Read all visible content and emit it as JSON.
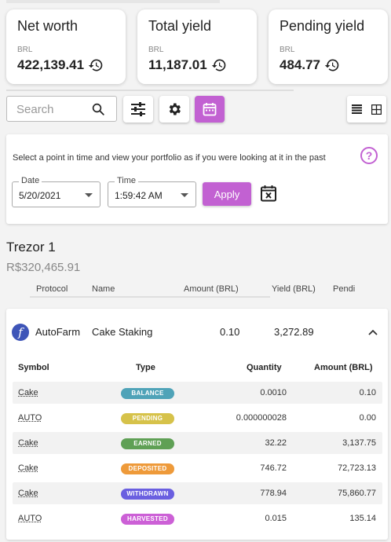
{
  "summary": [
    {
      "title": "Net worth",
      "currency": "BRL",
      "value": "422,139.41"
    },
    {
      "title": "Total yield",
      "currency": "BRL",
      "value": "11,187.01"
    },
    {
      "title": "Pending yield",
      "currency": "BRL",
      "value": "484.77"
    }
  ],
  "toolbar": {
    "search_placeholder": "Search"
  },
  "history": {
    "description": "Select a point in time and view your portfolio as if you were looking at it in the past",
    "help": "?",
    "date_label": "Date",
    "date_value": "5/20/2021",
    "time_label": "Time",
    "time_value": "1:59:42 AM",
    "apply_label": "Apply"
  },
  "wallet": {
    "name": "Trezor 1",
    "value": "R$320,465.91"
  },
  "columns": [
    "Protocol",
    "Name",
    "Amount (BRL)",
    "Yield (BRL)",
    "Pendi"
  ],
  "position": {
    "protocol": "AutoFarm",
    "name": "Cake Staking",
    "amount": "0.10",
    "yield": "3,272.89"
  },
  "table": {
    "headers": [
      "Symbol",
      "Type",
      "Quantity",
      "Amount (BRL)"
    ],
    "rows": [
      {
        "symbol": "Cake",
        "type": "BALANCE",
        "quantity": "0.0010",
        "amount": "0.10"
      },
      {
        "symbol": "AUTO",
        "type": "PENDING",
        "quantity": "0.000000028",
        "amount": "0.00"
      },
      {
        "symbol": "Cake",
        "type": "EARNED",
        "quantity": "32.22",
        "amount": "3,137.75"
      },
      {
        "symbol": "Cake",
        "type": "DEPOSITED",
        "quantity": "746.72",
        "amount": "72,723.13"
      },
      {
        "symbol": "Cake",
        "type": "WITHDRAWN",
        "quantity": "778.94",
        "amount": "75,860.77"
      },
      {
        "symbol": "AUTO",
        "type": "HARVESTED",
        "quantity": "0.015",
        "amount": "135.14"
      }
    ]
  },
  "colors": {
    "accent": "#c261d2",
    "balance": "#4fa3b8",
    "pending": "#d6c24a",
    "earned": "#5fa055",
    "deposited": "#ee9a3a",
    "withdrawn": "#6a5fe0",
    "harvested": "#cc60d6"
  }
}
